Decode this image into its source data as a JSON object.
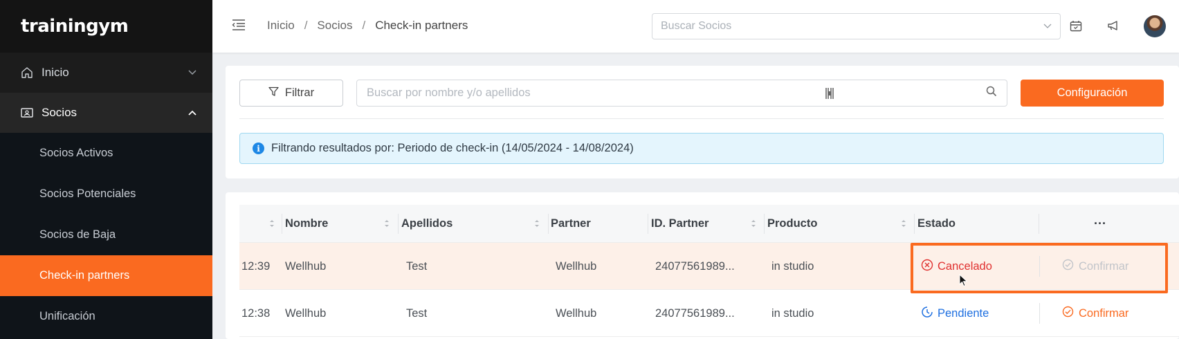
{
  "brand": {
    "logo_text": "trainingym",
    "accent_color": "#fa6a20"
  },
  "sidebar": {
    "items": [
      {
        "label": "Inicio",
        "icon": "home-icon",
        "expanded": false
      },
      {
        "label": "Socios",
        "icon": "members-card-icon",
        "expanded": true
      }
    ],
    "subitems": [
      {
        "label": "Socios Activos"
      },
      {
        "label": "Socios Potenciales"
      },
      {
        "label": "Socios de Baja"
      },
      {
        "label": "Check-in partners",
        "active": true
      },
      {
        "label": "Unificación"
      }
    ]
  },
  "header": {
    "breadcrumb": [
      "Inicio",
      "Socios",
      "Check-in partners"
    ],
    "member_search_placeholder": "Buscar Socios"
  },
  "filters": {
    "filter_button": "Filtrar",
    "search_placeholder": "Buscar por nombre y/o apellidos",
    "config_button": "Configuración",
    "alert_text": "Filtrando resultados por: Periodo de check-in (14/05/2024 - 14/08/2024)"
  },
  "table": {
    "columns": [
      "Nombre",
      "Apellidos",
      "Partner",
      "ID. Partner",
      "Producto",
      "Estado"
    ],
    "more_label": "···",
    "rows": [
      {
        "time": "12:39",
        "nombre": "Wellhub",
        "apellidos": "Test",
        "partner": "Wellhub",
        "id_partner": "24077561989...",
        "producto": "in studio",
        "estado": "Cancelado",
        "action": "Confirmar",
        "action_enabled": false
      },
      {
        "time": "12:38",
        "nombre": "Wellhub",
        "apellidos": "Test",
        "partner": "Wellhub",
        "id_partner": "24077561989...",
        "producto": "in studio",
        "estado": "Pendiente",
        "action": "Confirmar",
        "action_enabled": true
      }
    ]
  }
}
